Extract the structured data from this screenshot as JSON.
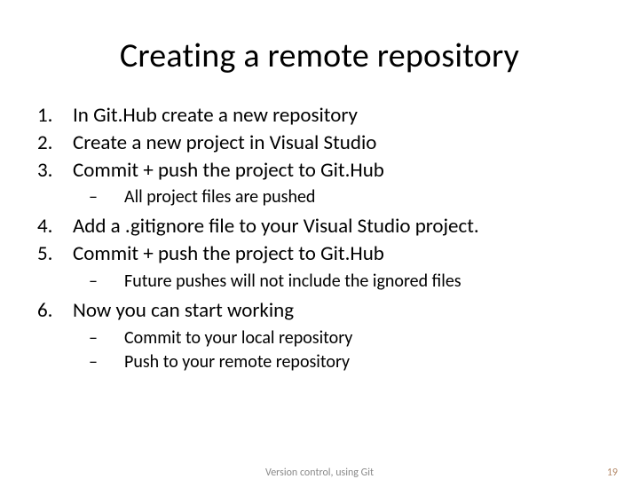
{
  "title": "Creating a remote repository",
  "items": [
    {
      "text": "In Git.Hub create a new repository"
    },
    {
      "text": "Create a new project in Visual Studio"
    },
    {
      "text": "Commit + push the project to Git.Hub",
      "sub": [
        "All project files are pushed"
      ]
    },
    {
      "text": "Add a .gitignore file to your Visual Studio project."
    },
    {
      "text": "Commit + push the project to Git.Hub",
      "sub": [
        "Future pushes will not include the ignored files"
      ]
    },
    {
      "text": "Now you can start working",
      "sub": [
        "Commit to your local repository",
        "Push to your remote repository"
      ]
    }
  ],
  "footer_center": "Version control, using Git",
  "footer_page": "19"
}
